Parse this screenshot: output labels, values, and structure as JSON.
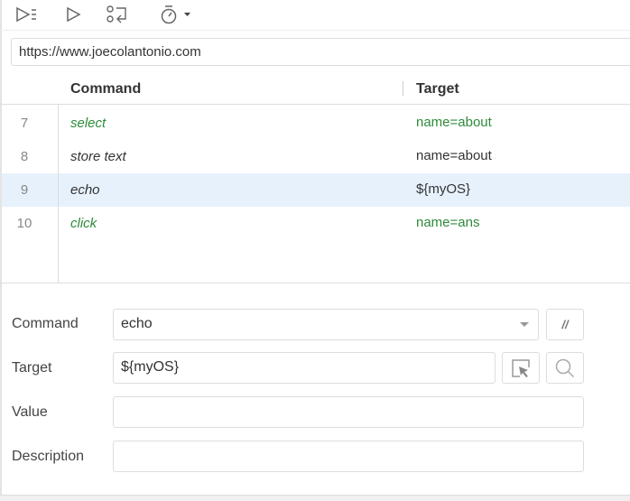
{
  "toolbar": {
    "run_all": "run-all-icon",
    "run": "run-icon",
    "step": "step-icon",
    "speed": "speed-icon"
  },
  "url": "https://www.joecolantonio.com",
  "table": {
    "headers": [
      "Command",
      "Target"
    ],
    "rows": [
      {
        "num": "7",
        "command": "select",
        "target": "name=about",
        "green": true
      },
      {
        "num": "8",
        "command": "store text",
        "target": "name=about",
        "green": false
      },
      {
        "num": "9",
        "command": "echo",
        "target": "${myOS}",
        "green": false,
        "selected": true
      },
      {
        "num": "10",
        "command": "click",
        "target": "name=ans",
        "green": true
      }
    ]
  },
  "editor": {
    "command_label": "Command",
    "command_value": "echo",
    "comment_button": "//",
    "target_label": "Target",
    "target_value": "${myOS}",
    "value_label": "Value",
    "value_value": "",
    "description_label": "Description",
    "description_value": ""
  }
}
